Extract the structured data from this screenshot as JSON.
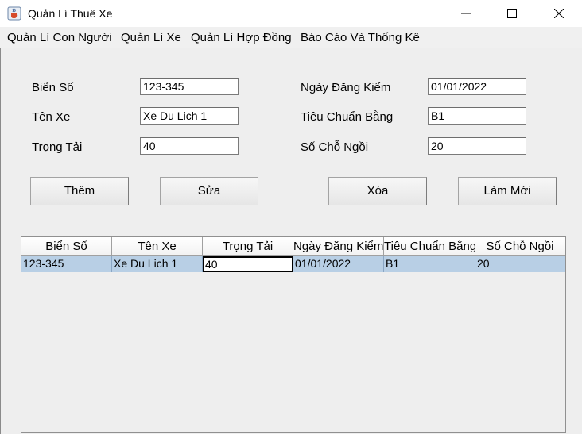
{
  "window": {
    "title": "Quản Lí Thuê Xe",
    "icon": "java-cup-icon"
  },
  "menu": {
    "items": [
      {
        "label": "Quản Lí Con Người"
      },
      {
        "label": "Quản Lí Xe"
      },
      {
        "label": "Quản Lí Hợp Đồng"
      },
      {
        "label": "Báo Cáo Và Thống Kê"
      }
    ]
  },
  "form": {
    "bien_so": {
      "label": "Biển Số",
      "value": "123-345"
    },
    "ten_xe": {
      "label": "Tên Xe",
      "value": "Xe Du Lich 1"
    },
    "trong_tai": {
      "label": "Trọng Tải",
      "value": "40"
    },
    "ngay_dang_kiem": {
      "label": "Ngày Đăng Kiểm",
      "value": "01/01/2022"
    },
    "tieu_chuan_bang": {
      "label": "Tiêu Chuẩn Bằng",
      "value": "B1"
    },
    "so_cho_ngoi": {
      "label": "Số Chỗ Ngồi",
      "value": "20"
    }
  },
  "buttons": {
    "them": "Thêm",
    "sua": "Sửa",
    "xoa": "Xóa",
    "lam_moi": "Làm Mới"
  },
  "table": {
    "columns": [
      "Biển Số",
      "Tên Xe",
      "Trọng Tải",
      "Ngày Đăng Kiểm",
      "Tiêu Chuẩn Bằng",
      "Số Chỗ Ngồi"
    ],
    "rows": [
      [
        "123-345",
        "Xe Du Lich 1",
        "40",
        "01/01/2022",
        "B1",
        "20"
      ]
    ]
  },
  "colors": {
    "selected_row": "#b8cfe5",
    "panel_bg": "#eeeeee"
  }
}
